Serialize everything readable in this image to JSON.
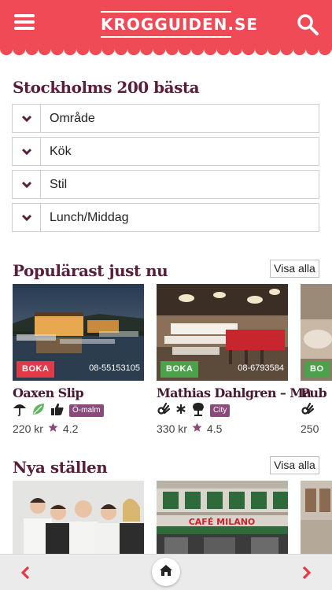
{
  "header": {
    "logo": "KROGGUIDEN.SE",
    "menu_icon": "hamburger-menu-icon",
    "search_icon": "search-icon"
  },
  "colors": {
    "brand_red": "#ef4a55",
    "heading_plum": "#5a1e3a",
    "boka_red": "#e23b47",
    "boka_green": "#4ca24a",
    "tag_purple": "#8b4a7a",
    "star": "#8b4a7a"
  },
  "main": {
    "title": "Stockholms 200 bästa",
    "filters": [
      {
        "label": "Område"
      },
      {
        "label": "Kök"
      },
      {
        "label": "Stil"
      },
      {
        "label": "Lunch/Middag"
      }
    ]
  },
  "popular": {
    "title": "Populärast just nu",
    "see_all": "Visa alla",
    "cards": [
      {
        "name": "Oaxen Slip",
        "boka": "BOKA",
        "phone": "08-55153105",
        "tag": "Ö-malm",
        "price": "220 kr",
        "rating": "4.2"
      },
      {
        "name": "Mathias Dahlgren – Ma",
        "boka": "BOKA",
        "phone": "08-6793584",
        "tag": "City",
        "price": "330 kr",
        "rating": "4.5"
      },
      {
        "name": "Pub",
        "boka": "BO",
        "price": "250"
      }
    ]
  },
  "new_places": {
    "title": "Nya ställen",
    "see_all": "Visa alla",
    "sign_text": "CAFÉ MILANO"
  },
  "bottom_nav": {
    "prev_icon": "chevron-left-icon",
    "home_icon": "home-icon",
    "next_icon": "chevron-right-icon"
  }
}
